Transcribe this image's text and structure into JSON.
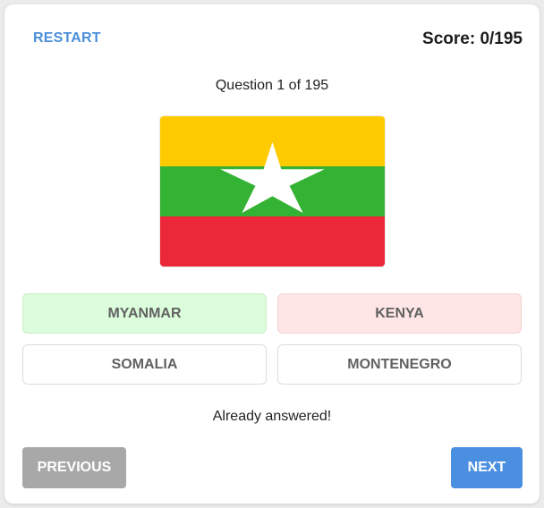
{
  "header": {
    "restart_label": "RESTART",
    "score_text": "Score: 0/195"
  },
  "question": {
    "text": "Question 1 of 195"
  },
  "flag": {
    "country": "Myanmar",
    "colors": {
      "yellow": "#FECB00",
      "green": "#34B233",
      "red": "#EA2839",
      "star": "#FFFFFF"
    }
  },
  "options": [
    {
      "label": "MYANMAR",
      "state": "correct"
    },
    {
      "label": "KENYA",
      "state": "wrong"
    },
    {
      "label": "SOMALIA",
      "state": "neutral"
    },
    {
      "label": "MONTENEGRO",
      "state": "neutral"
    }
  ],
  "status": {
    "text": "Already answered!"
  },
  "nav": {
    "previous_label": "PREVIOUS",
    "next_label": "NEXT"
  }
}
